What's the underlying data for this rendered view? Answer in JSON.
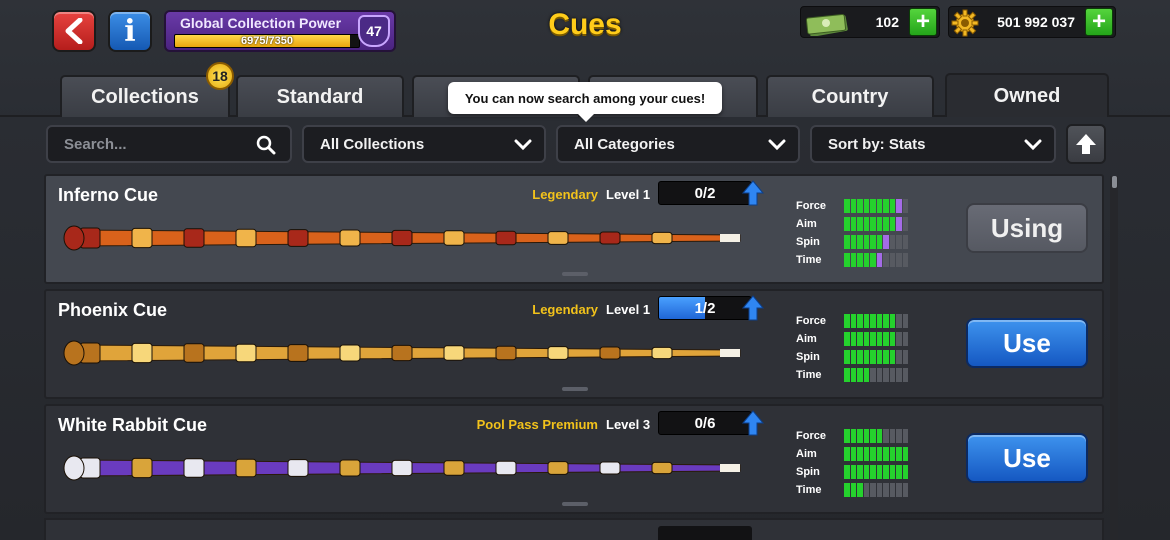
{
  "header": {
    "title": "Cues",
    "collection_power": {
      "label": "Global Collection Power",
      "progress_text": "6975/7350",
      "current": 6975,
      "max": 7350,
      "level": "47"
    },
    "cash": "102",
    "coins": "501 992 037",
    "plus_label": "+"
  },
  "tabs": [
    {
      "label": "Collections",
      "badge": "18"
    },
    {
      "label": "Standard"
    },
    {
      "label": ""
    },
    {
      "label": ""
    },
    {
      "label": "Country"
    },
    {
      "label": "Owned",
      "active": true
    }
  ],
  "tooltip": "You can now search among your cues!",
  "filters": {
    "search_placeholder": "Search...",
    "collections": "All Collections",
    "categories": "All Categories",
    "sort": "Sort by: Stats"
  },
  "stat_labels": [
    "Force",
    "Aim",
    "Spin",
    "Time"
  ],
  "cues": [
    {
      "name": "Inferno Cue",
      "rarity": "Legendary",
      "level": "Level 1",
      "progress": "0/2",
      "progress_fraction": 0,
      "button": "Using",
      "selected": true,
      "stats": {
        "force": [
          8,
          1
        ],
        "aim": [
          8,
          1
        ],
        "spin": [
          6,
          1
        ],
        "time": [
          5,
          1
        ]
      },
      "colors": [
        "#d9621b",
        "#f0b44a",
        "#a8281a"
      ]
    },
    {
      "name": "Phoenix Cue",
      "rarity": "Legendary",
      "level": "Level 1",
      "progress": "1/2",
      "progress_fraction": 0.5,
      "button": "Use",
      "selected": false,
      "stats": {
        "force": [
          8,
          0
        ],
        "aim": [
          8,
          0
        ],
        "spin": [
          8,
          0
        ],
        "time": [
          4,
          0
        ]
      },
      "colors": [
        "#e0a43a",
        "#f7d77a",
        "#b8731e"
      ]
    },
    {
      "name": "White Rabbit Cue",
      "rarity": "Pool Pass Premium",
      "level": "Level 3",
      "progress": "0/6",
      "progress_fraction": 0,
      "button": "Use",
      "selected": false,
      "stats": {
        "force": [
          6,
          0
        ],
        "aim": [
          10,
          0
        ],
        "spin": [
          10,
          0
        ],
        "time": [
          3,
          0
        ]
      },
      "colors": [
        "#6a3bbf",
        "#d9a43a",
        "#e8e8f0"
      ]
    }
  ]
}
